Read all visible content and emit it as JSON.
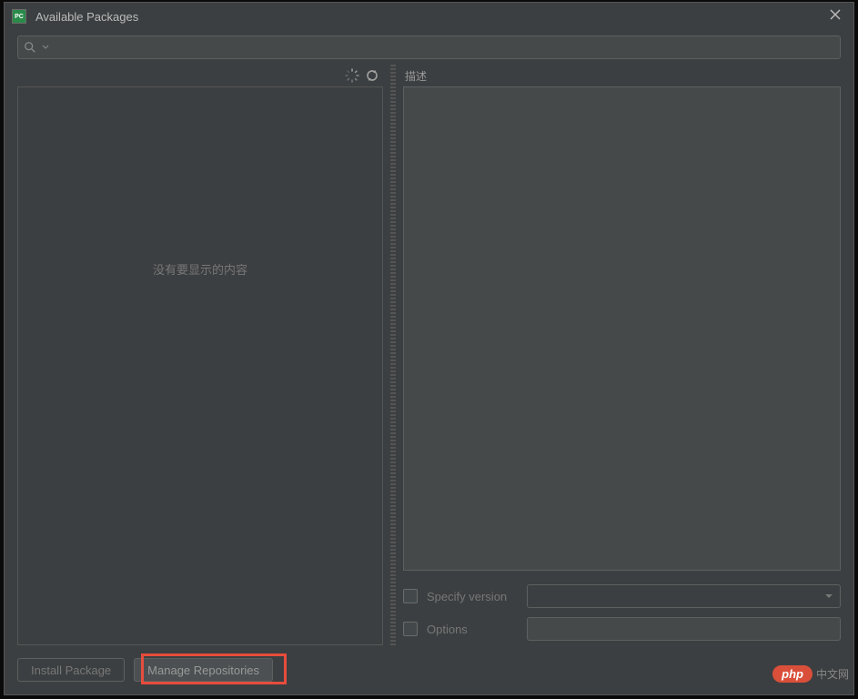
{
  "window": {
    "title": "Available Packages",
    "app_icon_text": "PC"
  },
  "search": {
    "placeholder": ""
  },
  "left": {
    "empty_message": "没有要显示的内容"
  },
  "right": {
    "description_label": "描述",
    "specify_version_label": "Specify version",
    "options_label": "Options"
  },
  "buttons": {
    "install": "Install Package",
    "manage_repos": "Manage Repositories"
  },
  "watermark": {
    "badge": "php",
    "text": "中文网"
  }
}
